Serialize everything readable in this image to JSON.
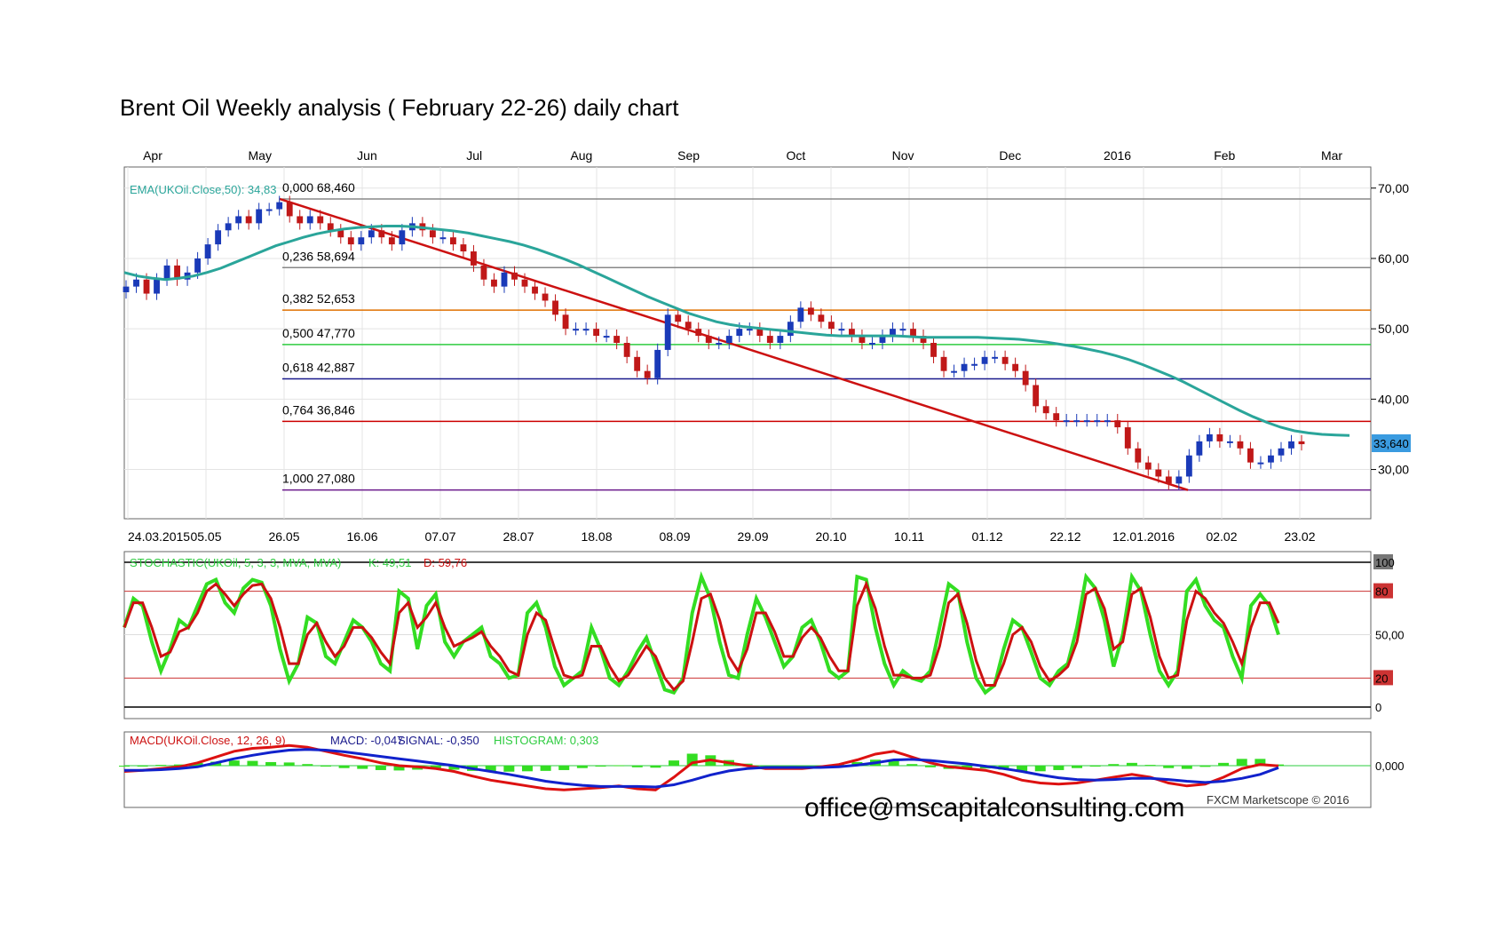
{
  "title": "Brent Oil Weekly analysis ( February 22-26) daily chart",
  "footer": {
    "email": "office@mscapitalconsulting.com",
    "credit": "FXCM Marketscope © 2016"
  },
  "chart_data": [
    {
      "type": "candlestick",
      "months": [
        "Apr",
        "May",
        "Jun",
        "Jul",
        "Aug",
        "Sep",
        "Oct",
        "Nov",
        "Dec",
        "2016",
        "Feb",
        "Mar"
      ],
      "dates": [
        "24.03.2015",
        "05.05",
        "26.05",
        "16.06",
        "07.07",
        "28.07",
        "18.08",
        "08.09",
        "29.09",
        "20.10",
        "10.11",
        "01.12",
        "22.12",
        "12.01.2016",
        "02.02",
        "23.02"
      ],
      "y_ticks": [
        "70,00",
        "60,00",
        "50,00",
        "40,00",
        "30,00"
      ],
      "ylim": [
        23,
        73
      ],
      "indicator_label": "EMA(UKOil.Close,50): 34,83",
      "last_price": "33,640",
      "fib_levels": [
        {
          "label": "0,000 68,460",
          "value": 68.46,
          "color": "#888888"
        },
        {
          "label": "0,236 58,694",
          "value": 58.694,
          "color": "#888888"
        },
        {
          "label": "0,382 52,653",
          "value": 52.653,
          "color": "#e07000"
        },
        {
          "label": "0,500 47,770",
          "value": 47.77,
          "color": "#2ecc40"
        },
        {
          "label": "0,618 42,887",
          "value": 42.887,
          "color": "#1a1a8c"
        },
        {
          "label": "0,764 36,846",
          "value": 36.846,
          "color": "#cc0000"
        },
        {
          "label": "1,000 27,080",
          "value": 27.08,
          "color": "#6b1a8c"
        }
      ],
      "series": [
        {
          "name": "Close",
          "values": [
            56,
            57,
            55,
            57,
            59,
            57,
            58,
            60,
            62,
            64,
            65,
            66,
            65,
            67,
            67,
            68,
            66,
            65,
            66,
            65,
            64,
            63,
            62,
            63,
            64,
            63,
            62,
            64,
            65,
            64,
            63,
            63,
            62,
            61,
            59,
            57,
            56,
            58,
            57,
            56,
            55,
            54,
            52,
            50,
            50,
            50,
            49,
            49,
            48,
            46,
            44,
            43,
            47,
            52,
            51,
            50,
            49,
            48,
            48,
            49,
            50,
            50,
            49,
            48,
            49,
            51,
            53,
            52,
            51,
            50,
            50,
            49,
            48,
            48,
            49,
            50,
            50,
            49,
            48,
            46,
            44,
            44,
            45,
            45,
            46,
            46,
            45,
            44,
            42,
            39,
            38,
            37,
            37,
            37,
            37,
            37,
            37,
            36,
            33,
            31,
            30,
            29,
            28,
            29,
            32,
            34,
            35,
            34,
            34,
            33,
            31,
            31,
            32,
            33,
            34,
            33.6
          ]
        },
        {
          "name": "EMA(UKOil.Close,50)",
          "values": [
            58,
            57.5,
            57.2,
            57,
            57.2,
            57.5,
            58,
            58.6,
            59.4,
            60.2,
            61,
            61.8,
            62.4,
            63,
            63.5,
            63.9,
            64.2,
            64.4,
            64.5,
            64.6,
            64.6,
            64.5,
            64.3,
            64.1,
            63.9,
            63.6,
            63.2,
            62.8,
            62.4,
            61.9,
            61.3,
            60.6,
            59.9,
            59.1,
            58.2,
            57.3,
            56.4,
            55.5,
            54.6,
            53.8,
            53,
            52.2,
            51.6,
            51,
            50.6,
            50.3,
            50.1,
            49.9,
            49.7,
            49.5,
            49.3,
            49.1,
            49,
            49,
            49,
            49,
            49,
            48.9,
            48.8,
            48.8,
            48.8,
            48.8,
            48.8,
            48.7,
            48.6,
            48.5,
            48.3,
            48.1,
            47.8,
            47.5,
            47.1,
            46.7,
            46.2,
            45.6,
            44.9,
            44.1,
            43.3,
            42.4,
            41.4,
            40.4,
            39.4,
            38.4,
            37.5,
            36.7,
            36,
            35.5,
            35.2,
            35,
            34.9,
            34.83
          ]
        }
      ]
    },
    {
      "type": "line",
      "indicator_label": "STOCHASTIC(UKOil, 5, 3, 3, MVA, MVA)",
      "k_label": "K: 49,51",
      "d_label": "D: 59,76",
      "y_ticks": [
        "100",
        "80",
        "50,00",
        "20",
        "0"
      ],
      "ylim": [
        0,
        100
      ],
      "series": [
        {
          "name": "K",
          "values": [
            55,
            75,
            70,
            45,
            25,
            40,
            60,
            55,
            70,
            85,
            88,
            72,
            65,
            82,
            88,
            86,
            70,
            40,
            18,
            30,
            62,
            58,
            35,
            30,
            45,
            60,
            55,
            45,
            30,
            25,
            80,
            75,
            40,
            70,
            78,
            45,
            35,
            45,
            50,
            55,
            35,
            30,
            20,
            22,
            65,
            72,
            55,
            28,
            15,
            20,
            25,
            55,
            40,
            20,
            15,
            25,
            38,
            48,
            30,
            12,
            10,
            20,
            65,
            90,
            75,
            45,
            22,
            20,
            50,
            75,
            62,
            45,
            28,
            35,
            55,
            60,
            45,
            25,
            20,
            25,
            90,
            88,
            55,
            30,
            15,
            25,
            20,
            18,
            25,
            55,
            85,
            80,
            45,
            20,
            10,
            15,
            40,
            60,
            55,
            38,
            20,
            15,
            25,
            30,
            55,
            90,
            82,
            60,
            28,
            50,
            90,
            80,
            50,
            25,
            15,
            25,
            80,
            88,
            70,
            60,
            55,
            35,
            20,
            70,
            78,
            70,
            50
          ]
        },
        {
          "name": "D",
          "values": [
            55,
            72,
            72,
            55,
            35,
            38,
            52,
            55,
            65,
            80,
            85,
            78,
            70,
            78,
            84,
            85,
            75,
            55,
            30,
            30,
            50,
            58,
            45,
            35,
            42,
            55,
            55,
            48,
            38,
            30,
            65,
            72,
            55,
            62,
            72,
            55,
            42,
            45,
            48,
            52,
            42,
            35,
            25,
            22,
            50,
            65,
            60,
            40,
            22,
            20,
            22,
            42,
            42,
            28,
            18,
            22,
            32,
            42,
            35,
            20,
            12,
            18,
            45,
            75,
            78,
            60,
            35,
            25,
            40,
            65,
            65,
            52,
            35,
            35,
            48,
            55,
            48,
            35,
            25,
            25,
            70,
            85,
            68,
            42,
            22,
            22,
            20,
            20,
            22,
            42,
            72,
            78,
            58,
            32,
            15,
            15,
            30,
            50,
            55,
            45,
            28,
            18,
            22,
            28,
            45,
            78,
            82,
            68,
            40,
            45,
            78,
            82,
            62,
            35,
            20,
            22,
            60,
            80,
            75,
            65,
            58,
            45,
            30,
            55,
            72,
            72,
            58
          ]
        }
      ]
    },
    {
      "type": "line",
      "indicator_label": "MACD(UKOil.Close, 12, 26, 9)",
      "macd_label": "MACD: -0,047",
      "signal_label": "SIGNAL: -0,350",
      "histogram_label": "HISTOGRAM: 0,303",
      "zero_label": "0,000",
      "series": [
        {
          "name": "MACD",
          "values": [
            -1,
            -0.8,
            -0.5,
            -0.2,
            0.5,
            1.5,
            2.5,
            3,
            3.2,
            3.5,
            3.2,
            2.5,
            1.8,
            1.2,
            0.5,
            0,
            -0.2,
            -0.5,
            -1,
            -1.8,
            -2.5,
            -3,
            -3.5,
            -4,
            -4.2,
            -4,
            -3.8,
            -3.5,
            -4,
            -4.2,
            -2,
            0.5,
            1,
            0.5,
            0,
            -0.5,
            -0.5,
            -0.5,
            -0.2,
            0.2,
            1,
            2,
            2.5,
            1.5,
            0.5,
            -0.2,
            -0.5,
            -0.8,
            -1.5,
            -2.5,
            -3,
            -3.2,
            -3,
            -2.5,
            -2,
            -1.5,
            -2,
            -3,
            -3.5,
            -3.2,
            -2,
            -0.5,
            0.2,
            -0.047
          ]
        },
        {
          "name": "SIGNAL",
          "values": [
            -0.8,
            -0.8,
            -0.7,
            -0.5,
            -0.2,
            0.5,
            1.2,
            1.8,
            2.3,
            2.7,
            2.8,
            2.7,
            2.4,
            2,
            1.6,
            1.2,
            0.8,
            0.4,
            0,
            -0.5,
            -1,
            -1.5,
            -2.1,
            -2.7,
            -3.1,
            -3.4,
            -3.6,
            -3.6,
            -3.6,
            -3.7,
            -3.3,
            -2.5,
            -1.6,
            -0.9,
            -0.5,
            -0.3,
            -0.3,
            -0.3,
            -0.3,
            -0.2,
            0.1,
            0.5,
            1,
            1.1,
            0.9,
            0.6,
            0.3,
            -0.1,
            -0.5,
            -1,
            -1.6,
            -2.1,
            -2.4,
            -2.5,
            -2.4,
            -2.2,
            -2.2,
            -2.4,
            -2.7,
            -2.9,
            -2.7,
            -2.2,
            -1.5,
            -0.35
          ]
        }
      ]
    }
  ]
}
